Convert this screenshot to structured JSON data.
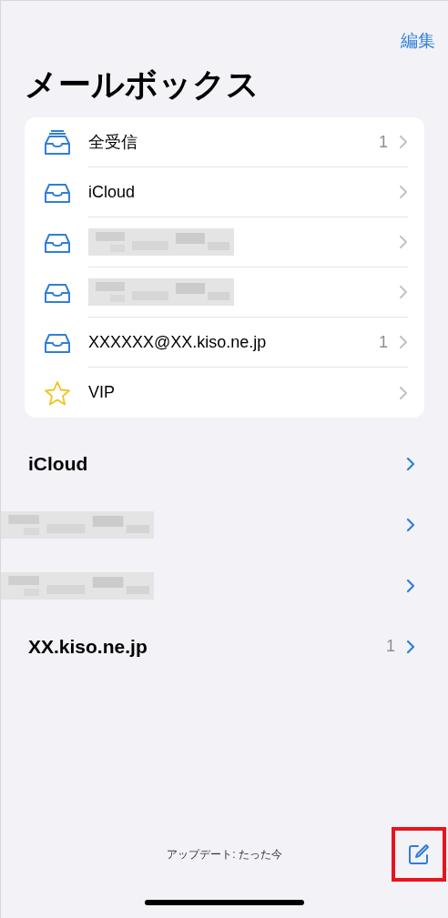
{
  "edit_button": "編集",
  "title": "メールボックス",
  "mailboxes": [
    {
      "kind": "all",
      "label": "全受信",
      "count": "1",
      "redacted": false
    },
    {
      "kind": "inbox",
      "label": "iCloud",
      "redacted": false
    },
    {
      "kind": "inbox",
      "redacted": true
    },
    {
      "kind": "inbox",
      "redacted": true
    },
    {
      "kind": "inbox",
      "label": "XXXXXX@XX.kiso.ne.jp",
      "count": "1",
      "redacted": false
    },
    {
      "kind": "vip",
      "label": "VIP",
      "redacted": false
    }
  ],
  "accounts": [
    {
      "label": "iCloud",
      "redacted": false
    },
    {
      "redacted": true
    },
    {
      "redacted": true
    },
    {
      "label": "XX.kiso.ne.jp",
      "count": "1",
      "redacted": false
    }
  ],
  "status": "アップデート: たった今",
  "compose": {
    "highlighted": true
  }
}
